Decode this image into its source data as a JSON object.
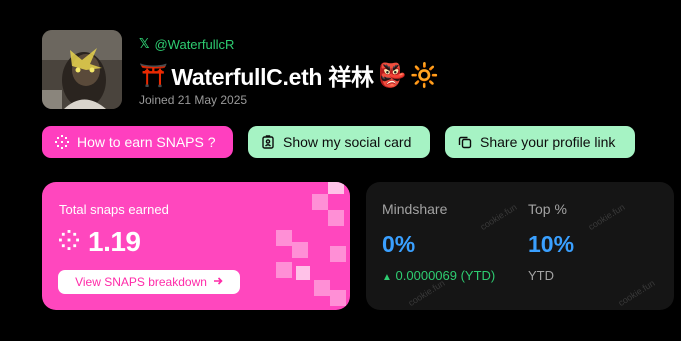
{
  "profile": {
    "avatar_alt": "profile picture",
    "handle": "@WaterfullcR",
    "display_name": "WaterfullC.eth 祥林",
    "name_emojis": [
      "⛩️",
      "👺",
      "🔆"
    ],
    "joined": "Joined 21 May 2025"
  },
  "actions": {
    "earn_label": "How to earn SNAPS ?",
    "social_card_label": "Show my social card",
    "share_label": "Share your profile link"
  },
  "snaps": {
    "title": "Total snaps earned",
    "value": "1.19",
    "breakdown_label": "View SNAPS breakdown"
  },
  "stats": {
    "mindshare": {
      "label": "Mindshare",
      "value": "0%",
      "change": "0.0000069 (YTD)",
      "change_color": "#2ecc71"
    },
    "top": {
      "label": "Top %",
      "value": "10%",
      "sub": "YTD"
    },
    "watermark": "cookie.fun"
  },
  "colors": {
    "pink": "#ff47be",
    "mint": "#a6f3c4",
    "blue": "#3aa0ff",
    "green": "#2ecc71"
  }
}
